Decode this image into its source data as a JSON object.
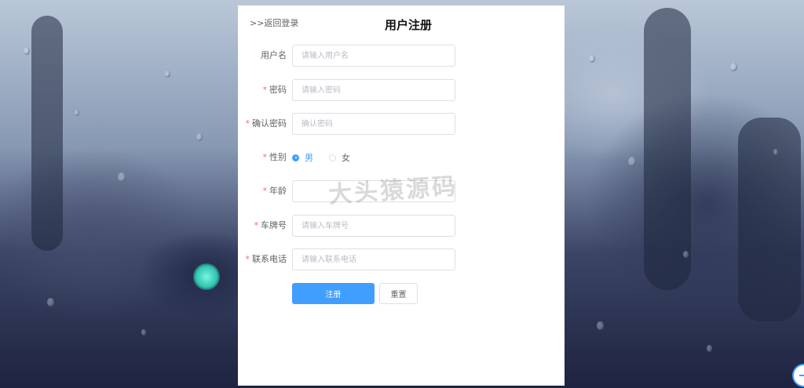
{
  "header": {
    "back_link": ">>返回登录",
    "title": "用户注册"
  },
  "form": {
    "username": {
      "label": "用户名",
      "required": false,
      "placeholder": "请输入用户名",
      "value": ""
    },
    "password": {
      "label": "密码",
      "required": true,
      "placeholder": "请输入密码",
      "value": ""
    },
    "confirm_password": {
      "label": "确认密码",
      "required": true,
      "placeholder": "确认密码",
      "value": ""
    },
    "gender": {
      "label": "性别",
      "required": true,
      "options": [
        "男",
        "女"
      ],
      "selected": "男"
    },
    "age": {
      "label": "年龄",
      "required": true,
      "placeholder": "",
      "value": ""
    },
    "plate": {
      "label": "车牌号",
      "required": true,
      "placeholder": "请输入车牌号",
      "value": ""
    },
    "phone": {
      "label": "联系电话",
      "required": true,
      "placeholder": "请输入联系电话",
      "value": ""
    }
  },
  "buttons": {
    "register": "注册",
    "reset": "重置"
  },
  "required_mark": "*",
  "watermark": "大头猿源码",
  "colors": {
    "primary": "#409eff",
    "required": "#f56c6c",
    "panel_bg": "#ffffff"
  }
}
